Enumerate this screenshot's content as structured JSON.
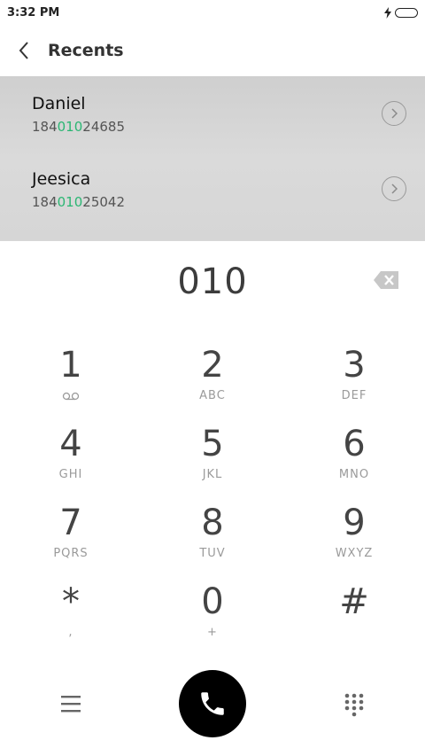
{
  "status_bar": {
    "time": "3:32 PM"
  },
  "header": {
    "title": "Recents"
  },
  "recents": [
    {
      "name": "Daniel",
      "number_prefix": "184",
      "number_match": "010",
      "number_suffix": "24685"
    },
    {
      "name": "Jeesica",
      "number_prefix": "184",
      "number_match": "010",
      "number_suffix": "25042"
    }
  ],
  "dialer": {
    "input": "010"
  },
  "keypad": [
    {
      "digit": "1",
      "letters": ""
    },
    {
      "digit": "2",
      "letters": "ABC"
    },
    {
      "digit": "3",
      "letters": "DEF"
    },
    {
      "digit": "4",
      "letters": "GHI"
    },
    {
      "digit": "5",
      "letters": "JKL"
    },
    {
      "digit": "6",
      "letters": "MNO"
    },
    {
      "digit": "7",
      "letters": "PQRS"
    },
    {
      "digit": "8",
      "letters": "TUV"
    },
    {
      "digit": "9",
      "letters": "WXYZ"
    },
    {
      "digit": "*",
      "letters": ","
    },
    {
      "digit": "0",
      "letters": "+"
    },
    {
      "digit": "#",
      "letters": ""
    }
  ],
  "colors": {
    "match_highlight": "#2bb673",
    "call_button": "#000000",
    "recents_background": "#d6d6d6"
  },
  "icons": {
    "back": "chevron-left-icon",
    "detail": "chevron-right-circle-icon",
    "backspace": "backspace-icon",
    "voicemail": "voicemail-icon",
    "menu": "hamburger-menu-icon",
    "call": "phone-icon",
    "keypad": "dialpad-icon",
    "charging": "charging-bolt-icon",
    "battery": "battery-icon"
  }
}
